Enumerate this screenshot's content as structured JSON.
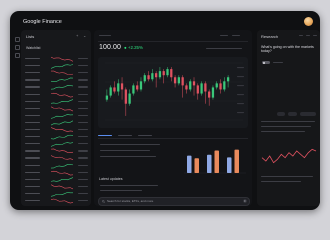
{
  "app": {
    "title": "Google Finance"
  },
  "lists_panel": {
    "title": "Lists",
    "add_label": "+",
    "menu_label": "⌄",
    "watchlist_label": "Watchlist",
    "rows": [
      {
        "trend": "down",
        "color": "#e05260"
      },
      {
        "trend": "up",
        "color": "#3ac77a"
      },
      {
        "trend": "down",
        "color": "#e05260"
      },
      {
        "trend": "up",
        "color": "#3ac77a"
      },
      {
        "trend": "up",
        "color": "#3ac77a"
      },
      {
        "trend": "down",
        "color": "#e05260"
      },
      {
        "trend": "up",
        "color": "#3ac77a"
      },
      {
        "trend": "down",
        "color": "#e05260"
      },
      {
        "trend": "up",
        "color": "#3ac77a"
      },
      {
        "trend": "up",
        "color": "#3ac77a"
      },
      {
        "trend": "down",
        "color": "#e05260"
      },
      {
        "trend": "up",
        "color": "#3ac77a"
      },
      {
        "trend": "up",
        "color": "#3ac77a"
      },
      {
        "trend": "down",
        "color": "#e05260"
      },
      {
        "trend": "down",
        "color": "#e05260"
      },
      {
        "trend": "up",
        "color": "#3ac77a"
      },
      {
        "trend": "down",
        "color": "#e05260"
      },
      {
        "trend": "up",
        "color": "#3ac77a"
      },
      {
        "trend": "down",
        "color": "#e05260"
      },
      {
        "trend": "up",
        "color": "#3ac77a"
      },
      {
        "trend": "down",
        "color": "#e05260"
      }
    ]
  },
  "quote": {
    "price": "100.00",
    "change": "+2.25%",
    "change_color": "#2ee07f"
  },
  "chart_data": {
    "type": "candlestick",
    "up_color": "#3ac77a",
    "down_color": "#e05260",
    "candles": [
      {
        "o": 44,
        "c": 46,
        "h": 49,
        "l": 43
      },
      {
        "o": 46,
        "c": 50,
        "h": 51,
        "l": 45
      },
      {
        "o": 50,
        "c": 48,
        "h": 53,
        "l": 47
      },
      {
        "o": 48,
        "c": 52,
        "h": 54,
        "l": 46
      },
      {
        "o": 52,
        "c": 49,
        "h": 55,
        "l": 44
      },
      {
        "o": 49,
        "c": 42,
        "h": 50,
        "l": 36
      },
      {
        "o": 42,
        "c": 47,
        "h": 49,
        "l": 41
      },
      {
        "o": 47,
        "c": 51,
        "h": 52,
        "l": 46
      },
      {
        "o": 51,
        "c": 49,
        "h": 53,
        "l": 48
      },
      {
        "o": 49,
        "c": 53,
        "h": 55,
        "l": 48
      },
      {
        "o": 53,
        "c": 56,
        "h": 57,
        "l": 52
      },
      {
        "o": 56,
        "c": 54,
        "h": 58,
        "l": 53
      },
      {
        "o": 54,
        "c": 57,
        "h": 59,
        "l": 53
      },
      {
        "o": 57,
        "c": 55,
        "h": 58,
        "l": 50
      },
      {
        "o": 55,
        "c": 58,
        "h": 60,
        "l": 54
      },
      {
        "o": 58,
        "c": 56,
        "h": 59,
        "l": 52
      },
      {
        "o": 56,
        "c": 59,
        "h": 60,
        "l": 55
      },
      {
        "o": 59,
        "c": 55,
        "h": 60,
        "l": 53
      },
      {
        "o": 55,
        "c": 52,
        "h": 56,
        "l": 50
      },
      {
        "o": 52,
        "c": 55,
        "h": 56,
        "l": 51
      },
      {
        "o": 55,
        "c": 51,
        "h": 56,
        "l": 45
      },
      {
        "o": 51,
        "c": 49,
        "h": 52,
        "l": 47
      },
      {
        "o": 49,
        "c": 53,
        "h": 54,
        "l": 48
      },
      {
        "o": 53,
        "c": 51,
        "h": 55,
        "l": 46
      },
      {
        "o": 51,
        "c": 47,
        "h": 52,
        "l": 44
      },
      {
        "o": 47,
        "c": 52,
        "h": 53,
        "l": 46
      },
      {
        "o": 52,
        "c": 48,
        "h": 53,
        "l": 42
      },
      {
        "o": 48,
        "c": 45,
        "h": 49,
        "l": 41
      },
      {
        "o": 45,
        "c": 50,
        "h": 51,
        "l": 44
      },
      {
        "o": 50,
        "c": 52,
        "h": 53,
        "l": 49
      },
      {
        "o": 52,
        "c": 49,
        "h": 54,
        "l": 47
      },
      {
        "o": 49,
        "c": 53,
        "h": 55,
        "l": 48
      },
      {
        "o": 53,
        "c": 55,
        "h": 56,
        "l": 50
      }
    ],
    "ylim": [
      34,
      62
    ]
  },
  "bar_chart": {
    "values": [
      20,
      17,
      21,
      26,
      18,
      27
    ],
    "colors": [
      "#8fa9e6",
      "#e98a5d",
      "#8fa9e6",
      "#e98a5d",
      "#8fa9e6",
      "#e98a5d"
    ],
    "ymax": 30
  },
  "news": {
    "title": "Latest updates"
  },
  "search": {
    "placeholder": "Search for stocks, ETFs, and more"
  },
  "research_panel": {
    "title": "Research",
    "question": "What's going on with the markets today?",
    "line_color": "#e05260",
    "line_values": [
      12,
      10,
      13,
      9,
      11,
      14,
      12,
      15,
      13,
      16,
      14,
      12,
      15,
      17,
      16
    ]
  }
}
